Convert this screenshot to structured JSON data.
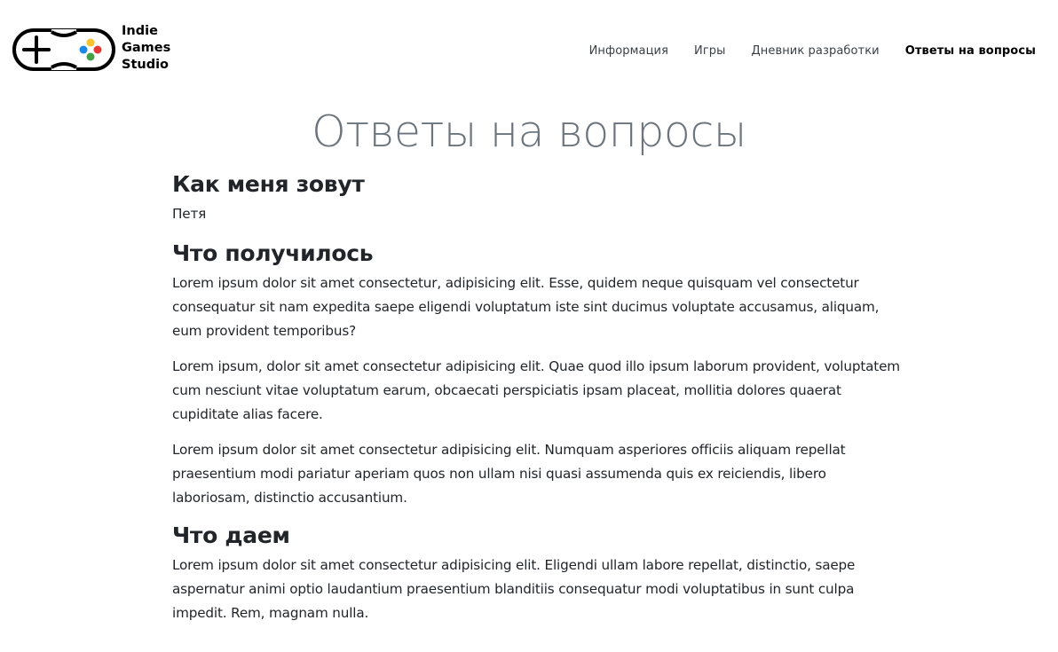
{
  "brand": {
    "line1": "Indie",
    "line2": "Games",
    "line3": "Studio",
    "logo_icon": "gamepad-icon",
    "button_colors": {
      "top": "#fbc02d",
      "right": "#e53935",
      "bottom": "#43a047",
      "left": "#1e88e5"
    }
  },
  "nav": {
    "items": [
      {
        "label": "Информация",
        "active": false
      },
      {
        "label": "Игры",
        "active": false
      },
      {
        "label": "Дневник разработки",
        "active": false
      },
      {
        "label": "Ответы на вопросы",
        "active": true
      }
    ]
  },
  "page": {
    "title": "Ответы на вопросы"
  },
  "sections": [
    {
      "heading": "Как меня зовут",
      "paragraphs": [
        "Петя"
      ]
    },
    {
      "heading": "Что получилось",
      "paragraphs": [
        "Lorem ipsum dolor sit amet consectetur, adipisicing elit. Esse, quidem neque quisquam vel consectetur consequatur sit nam expedita saepe eligendi voluptatum iste sint ducimus voluptate accusamus, aliquam, eum provident temporibus?",
        "Lorem ipsum, dolor sit amet consectetur adipisicing elit. Quae quod illo ipsum laborum provident, voluptatem cum nesciunt vitae voluptatum earum, obcaecati perspiciatis ipsam placeat, mollitia dolores quaerat cupiditate alias facere.",
        "Lorem ipsum dolor sit amet consectetur adipisicing elit. Numquam asperiores officiis aliquam repellat praesentium modi pariatur aperiam quos non ullam nisi quasi assumenda quis ex reiciendis, libero laboriosam, distinctio accusantium."
      ]
    },
    {
      "heading": "Что даем",
      "paragraphs": [
        "Lorem ipsum dolor sit amet consectetur adipisicing elit. Eligendi ullam labore repellat, distinctio, saepe aspernatur animi optio laudantium praesentium blanditiis consequatur modi voluptatibus in sunt culpa impedit. Rem, magnam nulla."
      ]
    }
  ]
}
